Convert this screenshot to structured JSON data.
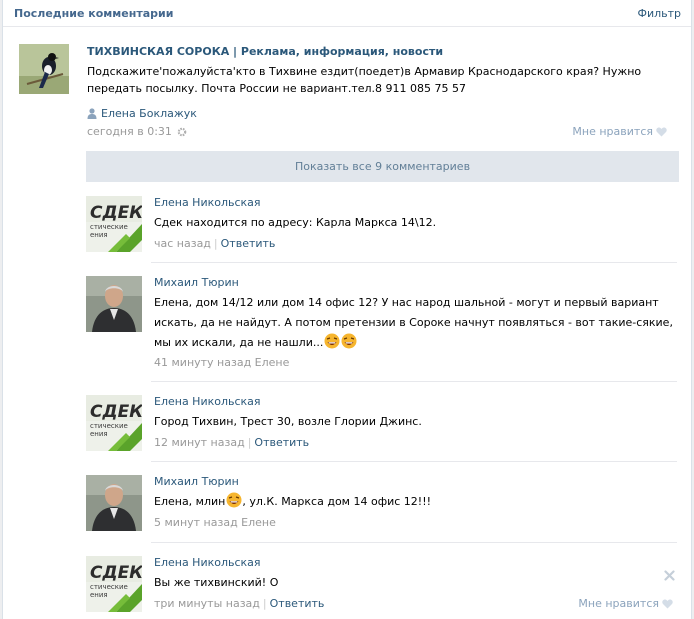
{
  "header": {
    "title": "Последние комментарии",
    "filter": "Фильтр"
  },
  "post": {
    "author": "ТИХВИНСКАЯ СОРОКА | Реклама, информация, новости",
    "text": "Подскажите'пожалуйста'кто в Тихвине ездит(поедет)в Армавир Краснодарского края? Нужно передать посылку. Почта России не вариант.тел.8 911 085 75 57",
    "signer": "Елена Боклажук",
    "date": "сегодня в 0:31",
    "like": "Мне нравится"
  },
  "show_all": "Показать все 9 комментариев",
  "comments": [
    {
      "name": "Елена Никольская",
      "text": "Сдек находится по адресу: Карла Маркса 14\\12.",
      "time": "час назад",
      "reply": "Ответить",
      "avatar": "cdek"
    },
    {
      "name": "Михаил Тюрин",
      "text": "Елена, дом 14/12 или дом 14 офис 12? У нас народ шальной - могут и первый вариант искать, да не найдут. А потом претензии в Сороке начнут появляться - вот такие-сякие, мы их искали, да не нашли...",
      "time": "41 минуту назад Елене",
      "avatar": "man"
    },
    {
      "name": "Елена Никольская",
      "text": "Город Тихвин, Трест 30, возле Глории Джинс.",
      "time": "12 минут назад",
      "reply": "Ответить",
      "avatar": "cdek"
    },
    {
      "name": "Михаил Тюрин",
      "text_a": "Елена, млин",
      "text_b": ", ул.К. Маркса дом 14 офис 12!!!",
      "time": "5 минут назад Елене",
      "avatar": "man"
    },
    {
      "name": "Елена Никольская",
      "text": "Вы же тихвинский! О",
      "time": "три минуты назад",
      "reply": "Ответить",
      "like": "Мне нравится",
      "avatar": "cdek"
    }
  ],
  "cdek_logo": {
    "brand": "СДЕК",
    "sub1": "стические",
    "sub2": "ения"
  },
  "colors": {
    "link": "#2b587a",
    "muted": "#999999",
    "button_bg": "#e1e6ec",
    "like": "#8ba3bc",
    "cdek_green": "#5aa32a"
  },
  "icons": [
    "person-icon",
    "gear-icon",
    "heart-icon",
    "close-icon",
    "laughing-emoji-icon"
  ]
}
